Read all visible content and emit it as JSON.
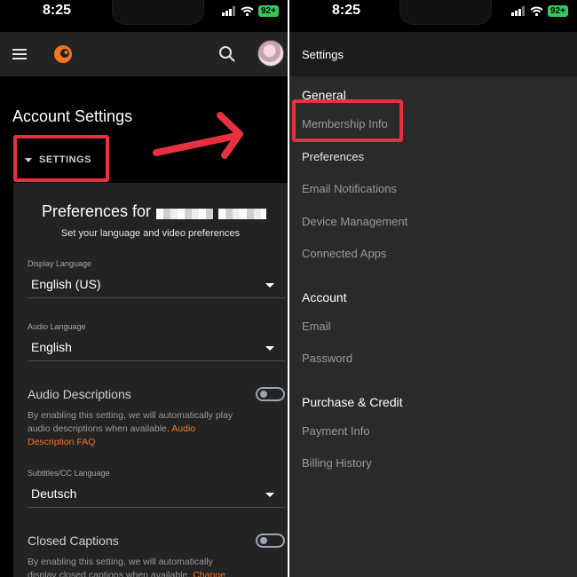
{
  "left": {
    "status_time": "8:25",
    "battery": "92+",
    "page_title": "Account Settings",
    "settings_toggle": "SETTINGS",
    "prefs": {
      "heading": "Preferences for",
      "subtitle": "Set your language and video preferences",
      "display_language_label": "Display Language",
      "display_language_value": "English (US)",
      "audio_language_label": "Audio Language",
      "audio_language_value": "English",
      "audio_descriptions_title": "Audio Descriptions",
      "audio_descriptions_desc": "By enabling this setting, we will automatically play audio descriptions when available. ",
      "audio_descriptions_link": "Audio Description FAQ",
      "subtitles_label": "Subtitles/CC Language",
      "subtitles_value": "Deutsch",
      "closed_captions_title": "Closed Captions",
      "closed_captions_desc": "By enabling this setting, we will automatically display closed captions when available. ",
      "closed_captions_link": "Change"
    }
  },
  "right": {
    "status_time": "8:25",
    "battery": "92+",
    "header_title": "Settings",
    "sections": [
      {
        "title": "General",
        "items": [
          "Membership Info",
          "Preferences",
          "Email Notifications",
          "Device Management",
          "Connected Apps"
        ]
      },
      {
        "title": "Account",
        "items": [
          "Email",
          "Password"
        ]
      },
      {
        "title": "Purchase & Credit",
        "items": [
          "Payment Info",
          "Billing History"
        ]
      }
    ]
  },
  "colors": {
    "accent": "#f47521",
    "annotation": "#e8313f"
  },
  "icons": [
    "hamburger-menu-icon",
    "crunchyroll-logo-icon",
    "search-icon",
    "avatar",
    "caret-down-icon",
    "right-arrow-annotation"
  ]
}
